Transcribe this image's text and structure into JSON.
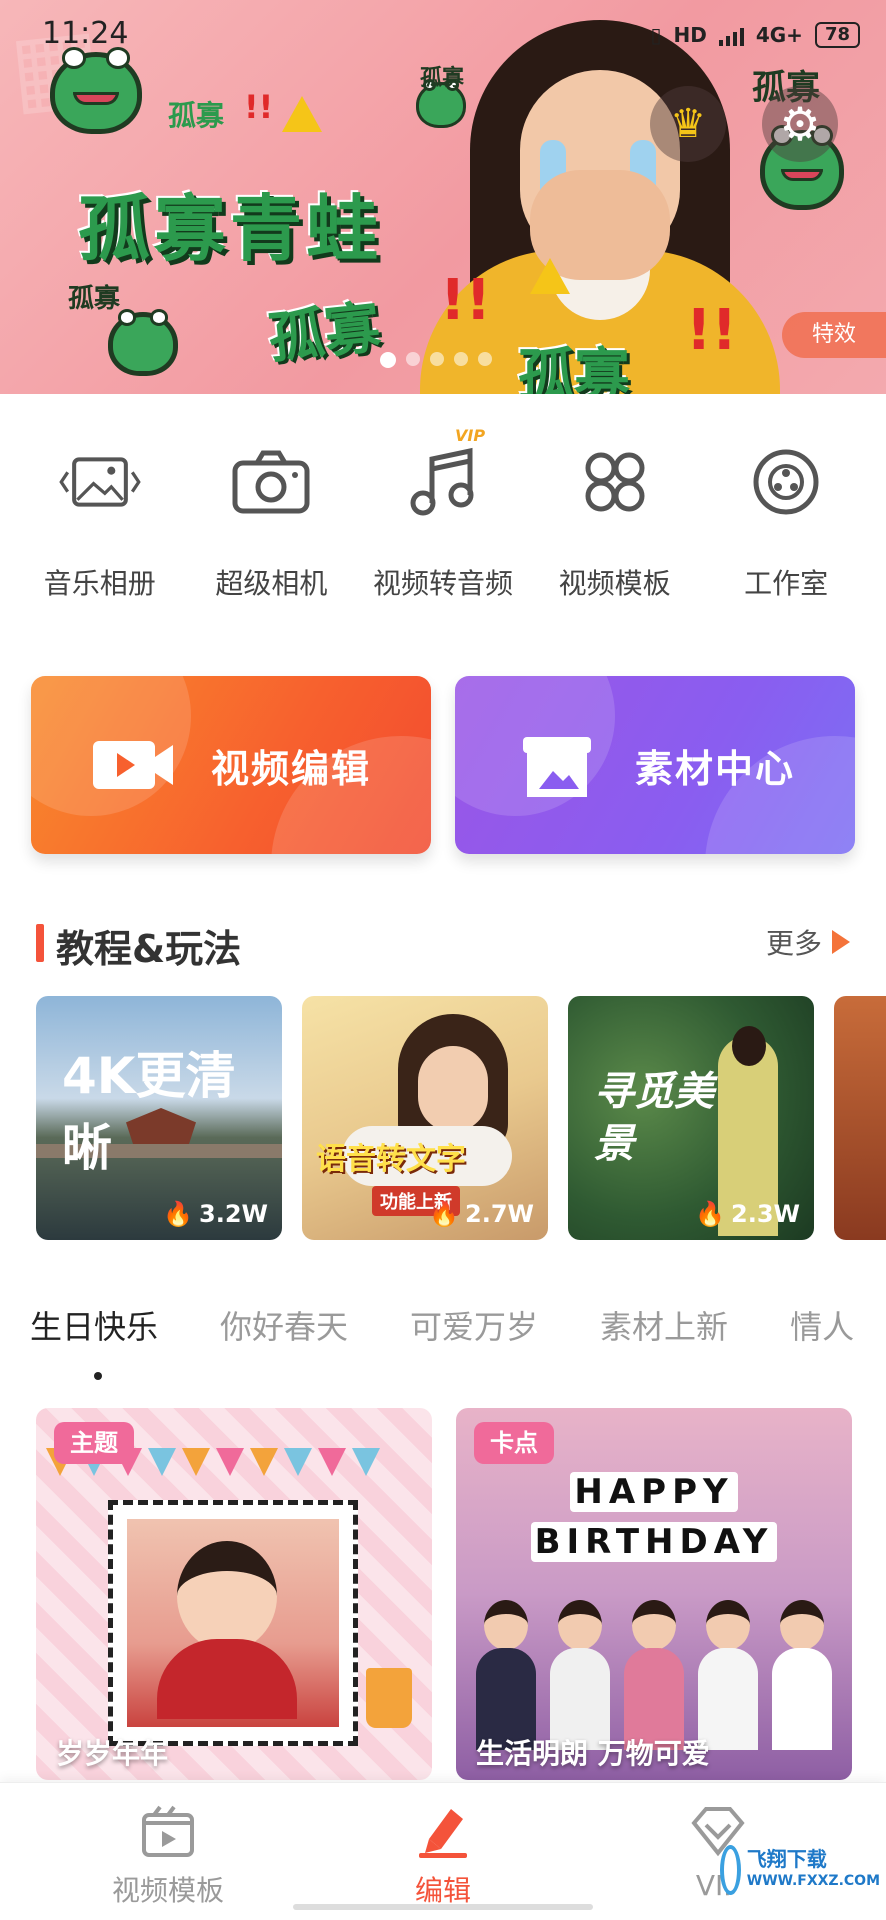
{
  "status": {
    "time": "11:24",
    "hd": "HD",
    "net": "4G+",
    "battery": "78"
  },
  "banner": {
    "title": "孤寡青蛙",
    "small_a": "孤寡",
    "excl": "!!",
    "mid_a": "孤寡",
    "mid_b": "孤寡",
    "tag": "特效",
    "page_count": 5,
    "active_page": 1
  },
  "tools": [
    {
      "label": "音乐相册",
      "icon": "image-icon"
    },
    {
      "label": "超级相机",
      "icon": "camera-icon"
    },
    {
      "label": "视频转音频",
      "icon": "music-note-icon",
      "badge": "VIP"
    },
    {
      "label": "视频模板",
      "icon": "template-grid-icon"
    },
    {
      "label": "工作室",
      "icon": "film-reel-icon"
    }
  ],
  "cards": {
    "edit": "视频编辑",
    "material": "素材中心"
  },
  "tutorials": {
    "title": "教程&玩法",
    "more": "更多",
    "items": [
      {
        "caption": "4K更清晰",
        "heat": "3.2W"
      },
      {
        "caption": "语音转文字",
        "sub": "功能上新",
        "heat": "2.7W"
      },
      {
        "caption": "寻觅美景",
        "heat": "2.3W"
      }
    ]
  },
  "categories": [
    "生日快乐",
    "你好春天",
    "可爱万岁",
    "素材上新",
    "情人"
  ],
  "templates": [
    {
      "badge": "主题",
      "title": "岁岁年年"
    },
    {
      "badge": "卡点",
      "title": "生活明朗 万物可爱",
      "hb1": "HAPPY",
      "hb2": "BIRTHDAY"
    }
  ],
  "bottom_nav": [
    {
      "label": "视频模板",
      "icon": "video-template-icon"
    },
    {
      "label": "编辑",
      "icon": "edit-pencil-icon",
      "active": true
    },
    {
      "label": "VIP",
      "icon": "vip-diamond-icon"
    }
  ],
  "watermark": {
    "name": "飞翔下载",
    "url": "WWW.FXXZ.COM"
  }
}
